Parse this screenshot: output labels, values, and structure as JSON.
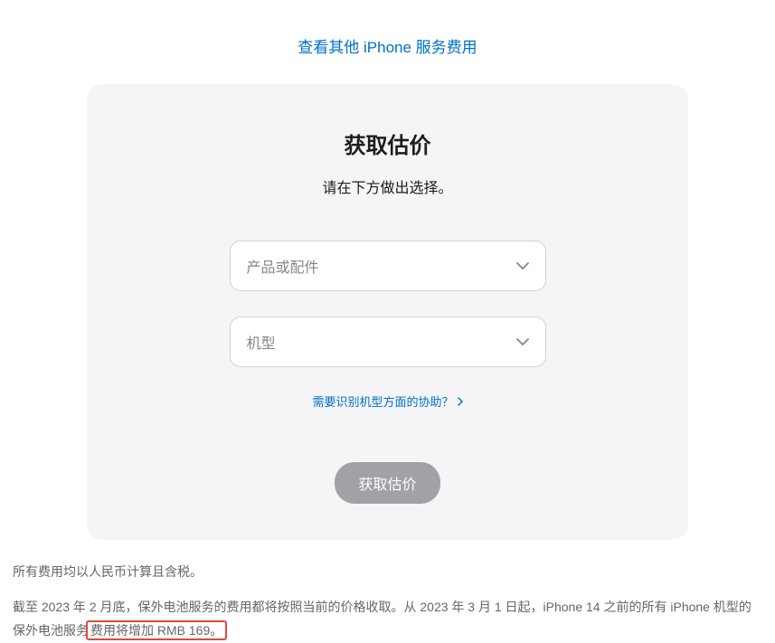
{
  "topLink": "查看其他 iPhone 服务费用",
  "card": {
    "title": "获取估价",
    "subtitle": "请在下方做出选择。",
    "select1": "产品或配件",
    "select2": "机型",
    "helpLink": "需要识别机型方面的协助？",
    "submitLabel": "获取估价"
  },
  "footer": {
    "line1": "所有费用均以人民币计算且含税。",
    "line2pre": "截至 2023 年 2 月底，保外电池服务的费用都将按照当前的价格收取。从 2023 年 3 月 1 日起，iPhone 14 之前的所有 iPhone 机型的保外电池服务",
    "line2highlight": "费用将增加 RMB 169。"
  }
}
